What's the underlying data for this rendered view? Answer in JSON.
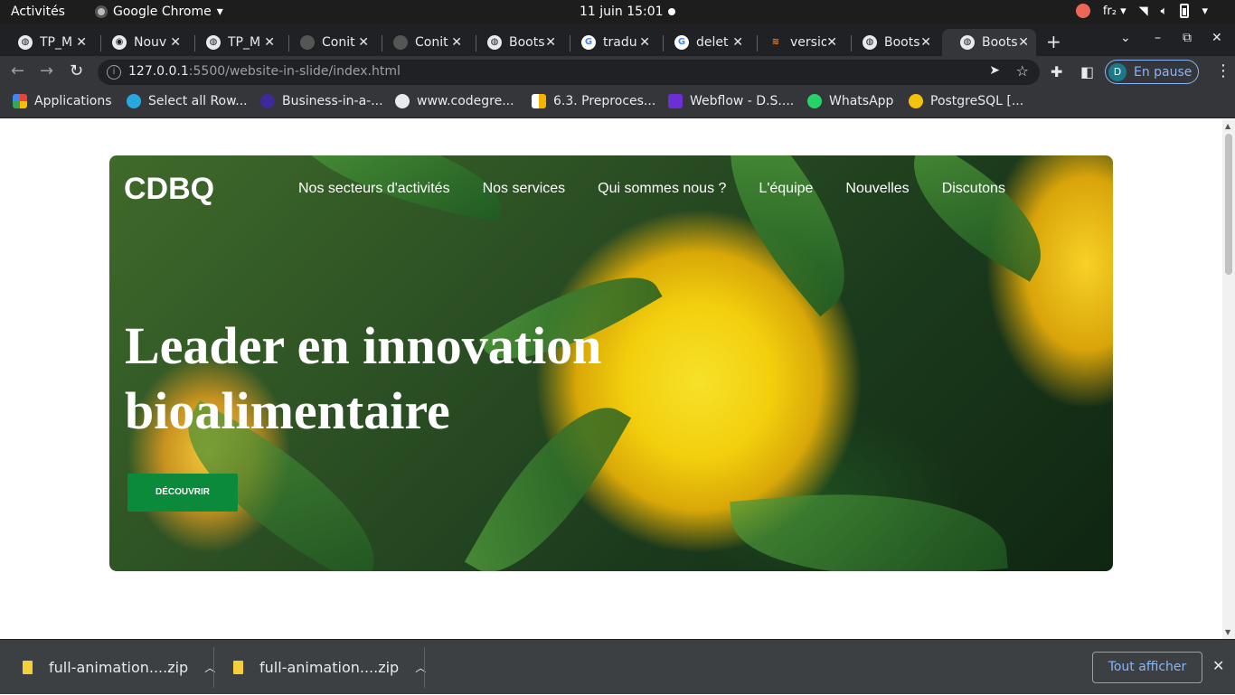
{
  "os_bar": {
    "activities": "Activités",
    "app_name": "Google Chrome",
    "clock": "11 juin  15:01",
    "keyboard": "fr₂"
  },
  "tabs": [
    {
      "title": "TP_M",
      "icon": "globe-icon"
    },
    {
      "title": "Nouv",
      "icon": "chrome-icon"
    },
    {
      "title": "TP_M",
      "icon": "globe-icon"
    },
    {
      "title": "Conit",
      "icon": "github-icon"
    },
    {
      "title": "Conit",
      "icon": "github-icon"
    },
    {
      "title": "Boots",
      "icon": "globe-icon"
    },
    {
      "title": "tradu",
      "icon": "google-icon"
    },
    {
      "title": "delet",
      "icon": "google-icon"
    },
    {
      "title": "versio",
      "icon": "stackoverflow-icon"
    },
    {
      "title": "Boots",
      "icon": "globe-icon"
    },
    {
      "title": "Boots",
      "icon": "globe-icon",
      "active": true
    }
  ],
  "address_bar": {
    "host": "127.0.0.1",
    "path": ":5500/website-in-slide/index.html"
  },
  "profile": {
    "initial": "D",
    "label": "En pause"
  },
  "bookmarks": [
    {
      "label": "Applications",
      "color": "#4285f4"
    },
    {
      "label": "Select all Row...",
      "color": "#29a8e0"
    },
    {
      "label": "Business-in-a-...",
      "color": "#3f2a9c"
    },
    {
      "label": "www.codegre...",
      "color": "#e8eaed"
    },
    {
      "label": "6.3. Preproces...",
      "color": "#f4b400"
    },
    {
      "label": "Webflow - D.S....",
      "color": "#6b2fd6"
    },
    {
      "label": "WhatsApp",
      "color": "#25d366"
    },
    {
      "label": "PostgreSQL [...",
      "color": "#f4c20d"
    }
  ],
  "site": {
    "brand": "CDBQ",
    "nav": [
      "Nos secteurs d'activités",
      "Nos services",
      "Qui sommes nous ?",
      "L'équipe",
      "Nouvelles",
      "Discutons"
    ],
    "headline": "Leader en innovation bioalimentaire",
    "cta": "DÉCOUVRIR"
  },
  "downloads": [
    {
      "name": "full-animation....zip"
    },
    {
      "name": "full-animation....zip"
    }
  ],
  "download_shelf": {
    "show_all": "Tout afficher"
  }
}
